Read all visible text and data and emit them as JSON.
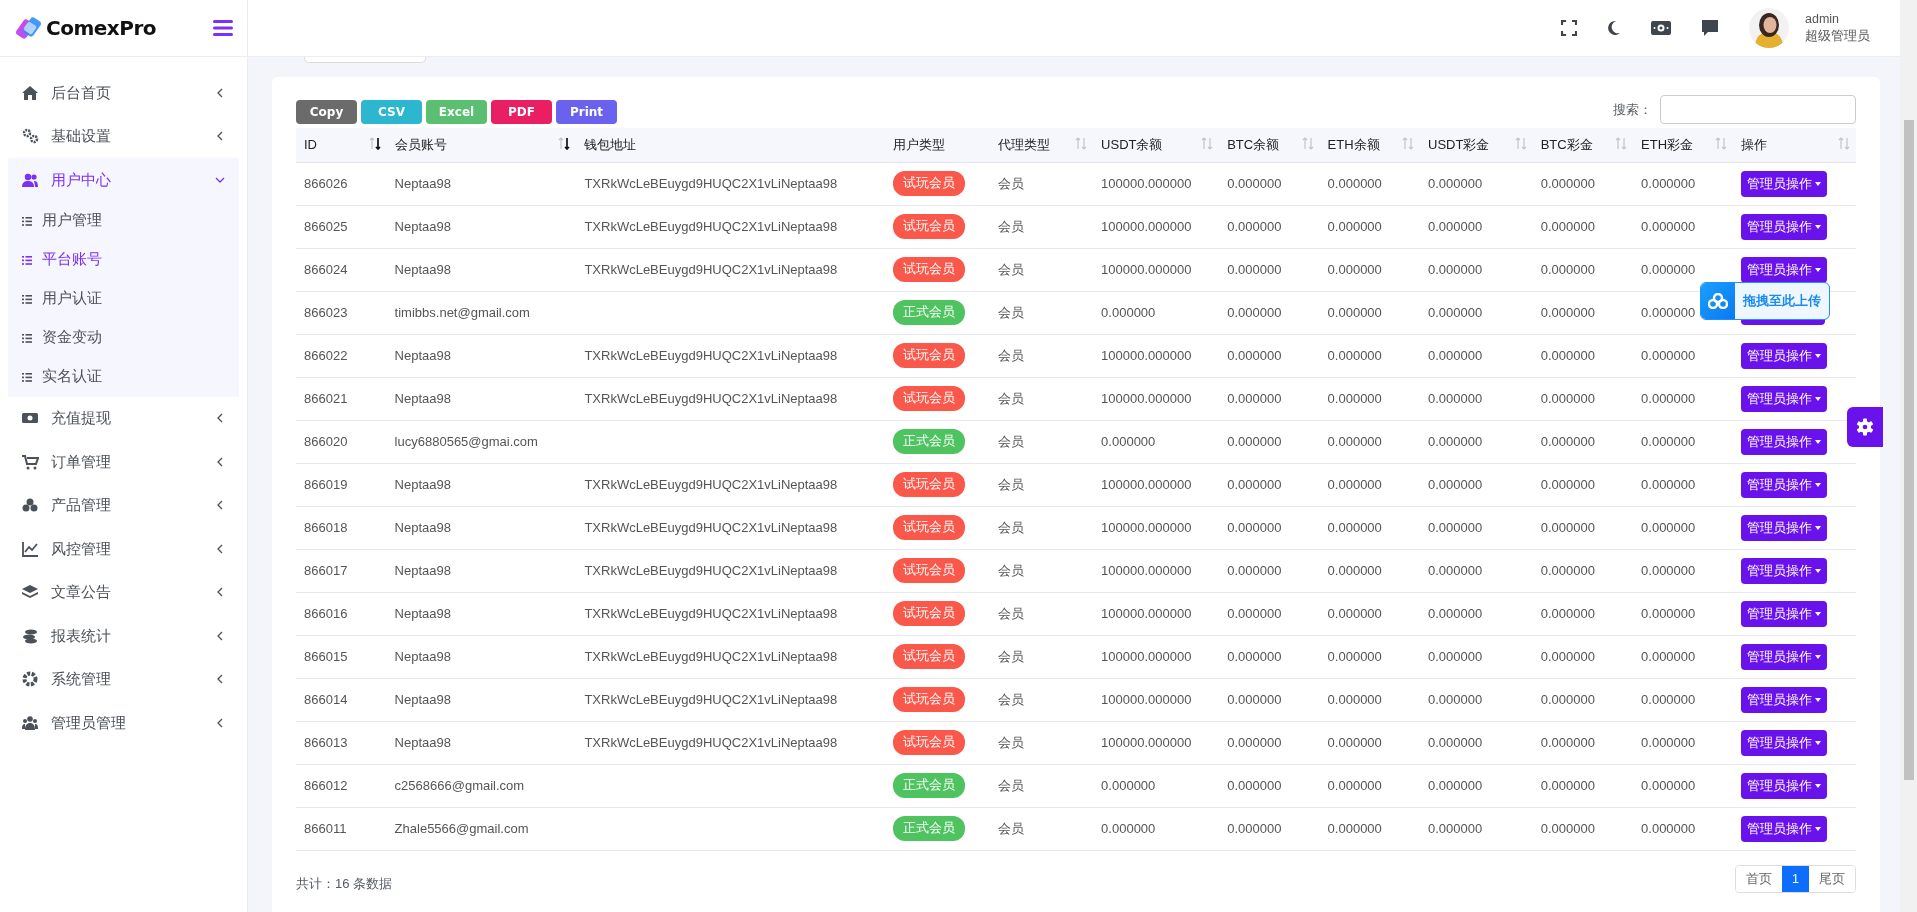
{
  "sidebar": {
    "logo": "ComexPro",
    "items": [
      {
        "label": "后台首页",
        "expanded": false
      },
      {
        "label": "基础设置",
        "expanded": false
      },
      {
        "label": "用户中心",
        "expanded": true,
        "children": [
          {
            "label": "用户管理",
            "selected": false
          },
          {
            "label": "平台账号",
            "selected": true
          },
          {
            "label": "用户认证",
            "selected": false
          },
          {
            "label": "资金变动",
            "selected": false
          },
          {
            "label": "实名认证",
            "selected": false
          }
        ]
      },
      {
        "label": "充值提现",
        "expanded": false
      },
      {
        "label": "订单管理",
        "expanded": false
      },
      {
        "label": "产品管理",
        "expanded": false
      },
      {
        "label": "风控管理",
        "expanded": false
      },
      {
        "label": "文章公告",
        "expanded": false
      },
      {
        "label": "报表统计",
        "expanded": false
      },
      {
        "label": "系统管理",
        "expanded": false
      },
      {
        "label": "管理员管理",
        "expanded": false
      }
    ]
  },
  "header": {
    "user": {
      "name": "admin",
      "role": "超级管理员"
    }
  },
  "toolbar": {
    "buttons": [
      {
        "label": "Copy",
        "color": "#6b6b6b"
      },
      {
        "label": "CSV",
        "color": "#2cb6cf"
      },
      {
        "label": "Excel",
        "color": "#5abf70"
      },
      {
        "label": "PDF",
        "color": "#e91e63"
      },
      {
        "label": "Print",
        "color": "#6a62ee"
      }
    ],
    "search_label": "搜索："
  },
  "table": {
    "columns": [
      {
        "label": "ID",
        "sorted": true
      },
      {
        "label": "会员账号",
        "sorted": true
      },
      {
        "label": "钱包地址"
      },
      {
        "label": "用户类型"
      },
      {
        "label": "代理类型",
        "sorted": false
      },
      {
        "label": "USDT余额",
        "sorted": false
      },
      {
        "label": "BTC余额",
        "sorted": false
      },
      {
        "label": "ETH余额",
        "sorted": false
      },
      {
        "label": "USDT彩金",
        "sorted": false
      },
      {
        "label": "BTC彩金",
        "sorted": false
      },
      {
        "label": "ETH彩金",
        "sorted": false
      },
      {
        "label": "操作",
        "sorted": false
      }
    ],
    "rows": [
      {
        "id": "866026",
        "account": "Neptaa98",
        "wallet": "TXRkWcLeBEuygd9HUQC2X1vLiNeptaa98",
        "user_type": {
          "label": "试玩会员",
          "color": "#f9584a"
        },
        "agent_type": "会员",
        "balances": [
          "100000.000000",
          "0.000000",
          "0.000000",
          "0.000000",
          "0.000000",
          "0.000000"
        ],
        "action": "管理员操作"
      },
      {
        "id": "866025",
        "account": "Neptaa98",
        "wallet": "TXRkWcLeBEuygd9HUQC2X1vLiNeptaa98",
        "user_type": {
          "label": "试玩会员",
          "color": "#f9584a"
        },
        "agent_type": "会员",
        "balances": [
          "100000.000000",
          "0.000000",
          "0.000000",
          "0.000000",
          "0.000000",
          "0.000000"
        ],
        "action": "管理员操作"
      },
      {
        "id": "866024",
        "account": "Neptaa98",
        "wallet": "TXRkWcLeBEuygd9HUQC2X1vLiNeptaa98",
        "user_type": {
          "label": "试玩会员",
          "color": "#f9584a"
        },
        "agent_type": "会员",
        "balances": [
          "100000.000000",
          "0.000000",
          "0.000000",
          "0.000000",
          "0.000000",
          "0.000000"
        ],
        "action": "管理员操作"
      },
      {
        "id": "866023",
        "account": "timibbs.net@gmail.com",
        "user_type": {
          "label": "正式会员",
          "color": "#4ec360"
        },
        "agent_type": "会员",
        "balances": [
          "0.000000",
          "0.000000",
          "0.000000",
          "0.000000",
          "0.000000",
          "0.000000"
        ]
      },
      {
        "id": "866022",
        "account": "Neptaa98",
        "wallet": "TXRkWcLeBEuygd9HUQC2X1vLiNeptaa98",
        "user_type": {
          "label": "试玩会员",
          "color": "#f9584a"
        },
        "agent_type": "会员",
        "balances": [
          "100000.000000",
          "0.000000",
          "0.000000",
          "0.000000",
          "0.000000",
          "0.000000"
        ],
        "action": "管理员操作"
      },
      {
        "id": "866021",
        "account": "Neptaa98",
        "wallet": "TXRkWcLeBEuygd9HUQC2X1vLiNeptaa98",
        "user_type": {
          "label": "试玩会员",
          "color": "#f9584a"
        },
        "agent_type": "会员",
        "balances": [
          "100000.000000",
          "0.000000",
          "0.000000",
          "0.000000",
          "0.000000",
          "0.000000"
        ],
        "action": "管理员操作"
      },
      {
        "id": "866020",
        "account": "lucy6880565@gmai.com",
        "user_type": {
          "label": "正式会员",
          "color": "#4ec360"
        },
        "agent_type": "会员",
        "balances": [
          "0.000000",
          "0.000000",
          "0.000000",
          "0.000000",
          "0.000000",
          "0.000000"
        ],
        "action": "管理员操作"
      },
      {
        "id": "866019",
        "account": "Neptaa98",
        "wallet": "TXRkWcLeBEuygd9HUQC2X1vLiNeptaa98",
        "user_type": {
          "label": "试玩会员",
          "color": "#f9584a"
        },
        "agent_type": "会员",
        "balances": [
          "100000.000000",
          "0.000000",
          "0.000000",
          "0.000000",
          "0.000000",
          "0.000000"
        ],
        "action": "管理员操作"
      },
      {
        "id": "866018",
        "account": "Neptaa98",
        "wallet": "TXRkWcLeBEuygd9HUQC2X1vLiNeptaa98",
        "user_type": {
          "label": "试玩会员",
          "color": "#f9584a"
        },
        "agent_type": "会员",
        "balances": [
          "100000.000000",
          "0.000000",
          "0.000000",
          "0.000000",
          "0.000000",
          "0.000000"
        ],
        "action": "管理员操作"
      },
      {
        "id": "866017",
        "account": "Neptaa98",
        "wallet": "TXRkWcLeBEuygd9HUQC2X1vLiNeptaa98",
        "user_type": {
          "label": "试玩会员",
          "color": "#f9584a"
        },
        "agent_type": "会员",
        "balances": [
          "100000.000000",
          "0.000000",
          "0.000000",
          "0.000000",
          "0.000000",
          "0.000000"
        ],
        "action": "管理员操作"
      },
      {
        "id": "866016",
        "account": "Neptaa98",
        "wallet": "TXRkWcLeBEuygd9HUQC2X1vLiNeptaa98",
        "user_type": {
          "label": "试玩会员",
          "color": "#f9584a"
        },
        "agent_type": "会员",
        "balances": [
          "100000.000000",
          "0.000000",
          "0.000000",
          "0.000000",
          "0.000000",
          "0.000000"
        ],
        "action": "管理员操作"
      },
      {
        "id": "866015",
        "account": "Neptaa98",
        "wallet": "TXRkWcLeBEuygd9HUQC2X1vLiNeptaa98",
        "user_type": {
          "label": "试玩会员",
          "color": "#f9584a"
        },
        "agent_type": "会员",
        "balances": [
          "100000.000000",
          "0.000000",
          "0.000000",
          "0.000000",
          "0.000000",
          "0.000000"
        ],
        "action": "管理员操作"
      },
      {
        "id": "866014",
        "account": "Neptaa98",
        "wallet": "TXRkWcLeBEuygd9HUQC2X1vLiNeptaa98",
        "user_type": {
          "label": "试玩会员",
          "color": "#f9584a"
        },
        "agent_type": "会员",
        "balances": [
          "100000.000000",
          "0.000000",
          "0.000000",
          "0.000000",
          "0.000000",
          "0.000000"
        ],
        "action": "管理员操作"
      },
      {
        "id": "866013",
        "account": "Neptaa98",
        "wallet": "TXRkWcLeBEuygd9HUQC2X1vLiNeptaa98",
        "user_type": {
          "label": "试玩会员",
          "color": "#f9584a"
        },
        "agent_type": "会员",
        "balances": [
          "100000.000000",
          "0.000000",
          "0.000000",
          "0.000000",
          "0.000000",
          "0.000000"
        ],
        "action": "管理员操作"
      },
      {
        "id": "866012",
        "account": "c2568666@gmail.com",
        "user_type": {
          "label": "正式会员",
          "color": "#4ec360"
        },
        "agent_type": "会员",
        "balances": [
          "0.000000",
          "0.000000",
          "0.000000",
          "0.000000",
          "0.000000",
          "0.000000"
        ],
        "action": "管理员操作"
      },
      {
        "id": "866011",
        "account": "Zhale5566@gmail.com",
        "user_type": {
          "label": "正式会员",
          "color": "#4ec360"
        },
        "agent_type": "会员",
        "balances": [
          "0.000000",
          "0.000000",
          "0.000000",
          "0.000000",
          "0.000000",
          "0.000000"
        ],
        "action": "管理员操作"
      }
    ]
  },
  "footer": {
    "total": "共计：16 条数据",
    "pagination": [
      {
        "label": "首页",
        "selected": false
      },
      {
        "label": "1",
        "selected": true
      },
      {
        "label": "尾页",
        "selected": false
      }
    ]
  },
  "upload_overlay": {
    "label": "拖拽至此上传"
  }
}
